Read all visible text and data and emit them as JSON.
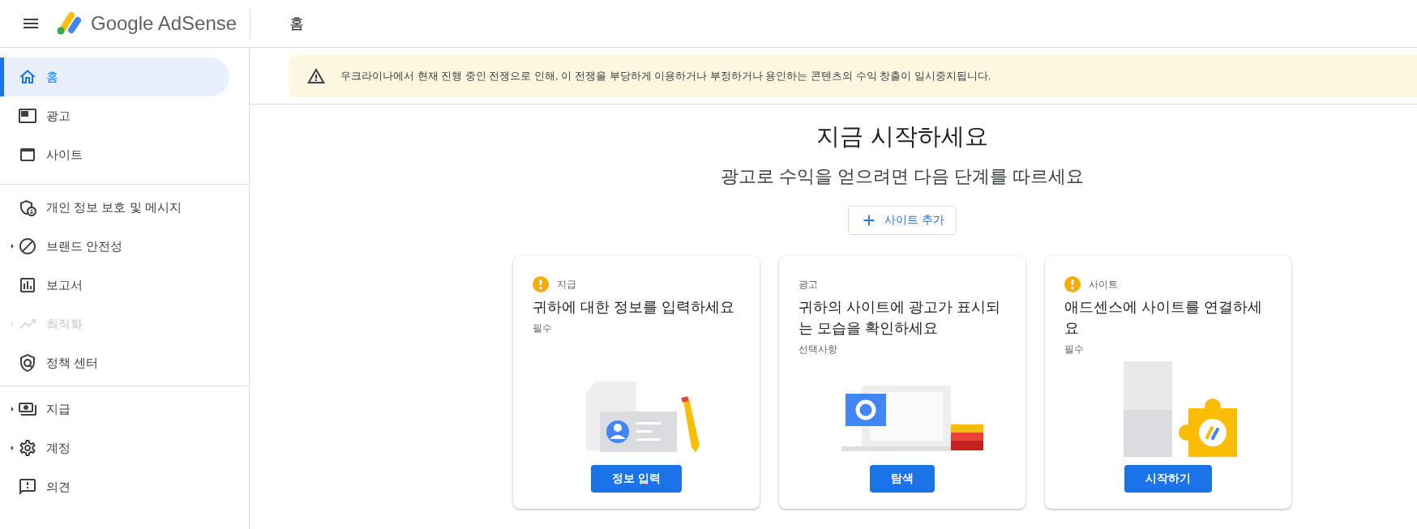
{
  "header": {
    "product": "Google AdSense",
    "page_title": "홈"
  },
  "sidebar": {
    "groups": [
      [
        {
          "label": "홈",
          "selected": true,
          "expandable": false,
          "disabled": false
        },
        {
          "label": "광고",
          "selected": false,
          "expandable": false,
          "disabled": false
        },
        {
          "label": "사이트",
          "selected": false,
          "expandable": false,
          "disabled": false
        }
      ],
      [
        {
          "label": "개인 정보 보호 및 메시지",
          "selected": false,
          "expandable": false,
          "disabled": false
        },
        {
          "label": "브랜드 안전성",
          "selected": false,
          "expandable": true,
          "disabled": false
        },
        {
          "label": "보고서",
          "selected": false,
          "expandable": false,
          "disabled": false
        },
        {
          "label": "최적화",
          "selected": false,
          "expandable": true,
          "disabled": true
        },
        {
          "label": "정책 센터",
          "selected": false,
          "expandable": false,
          "disabled": false
        }
      ],
      [
        {
          "label": "지급",
          "selected": false,
          "expandable": true,
          "disabled": false
        },
        {
          "label": "계정",
          "selected": false,
          "expandable": true,
          "disabled": false
        },
        {
          "label": "의견",
          "selected": false,
          "expandable": false,
          "disabled": false
        }
      ]
    ]
  },
  "banner": {
    "text": "우크라이나에서 현재 진행 중인 전쟁으로 인해, 이 전쟁을 부당하게 이용하거나 부정하거나 용인하는 콘텐츠의 수익 창출이 일시중지됩니다."
  },
  "main": {
    "title": "지금 시작하세요",
    "subtitle": "광고로 수익을 얻으려면 다음 단계를 따르세요",
    "add_button": "사이트 추가"
  },
  "cards": [
    {
      "alert": true,
      "category": "지급",
      "title": "귀하에 대한 정보를 입력하세요",
      "requirement": "필수",
      "button": "정보 입력"
    },
    {
      "alert": false,
      "category": "광고",
      "title": "귀하의 사이트에 광고가 표시되는 모습을 확인하세요",
      "requirement": "선택사항",
      "button": "탐색"
    },
    {
      "alert": true,
      "category": "사이트",
      "title": "애드센스에 사이트를 연결하세요",
      "requirement": "필수",
      "button": "시작하기"
    }
  ]
}
